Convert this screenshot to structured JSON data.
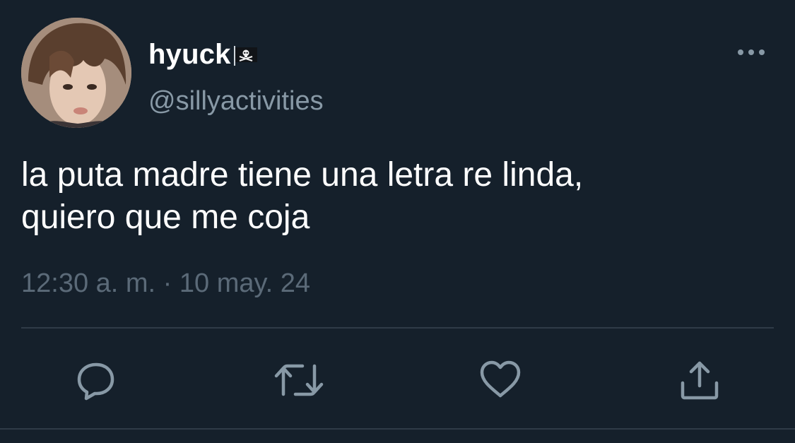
{
  "tweet": {
    "display_name": "hyuck",
    "handle": "@sillyactivities",
    "text_lines": [
      "la puta madre tiene una letra re linda,",
      "quiero que me coja"
    ],
    "timestamp": "12:30 a. m. · 10 may. 24"
  },
  "icons": {
    "name_badge": "pirate-flag-icon",
    "more": "more-options-icon",
    "reply": "reply-icon",
    "retweet": "retweet-icon",
    "like": "heart-icon",
    "share": "share-icon"
  },
  "colors": {
    "background": "#15202b",
    "primary_text": "#ffffff",
    "secondary_text": "#8899a6",
    "timestamp_text": "#5b6a78",
    "icon": "#8899a6",
    "divider": "#2f3b47"
  }
}
